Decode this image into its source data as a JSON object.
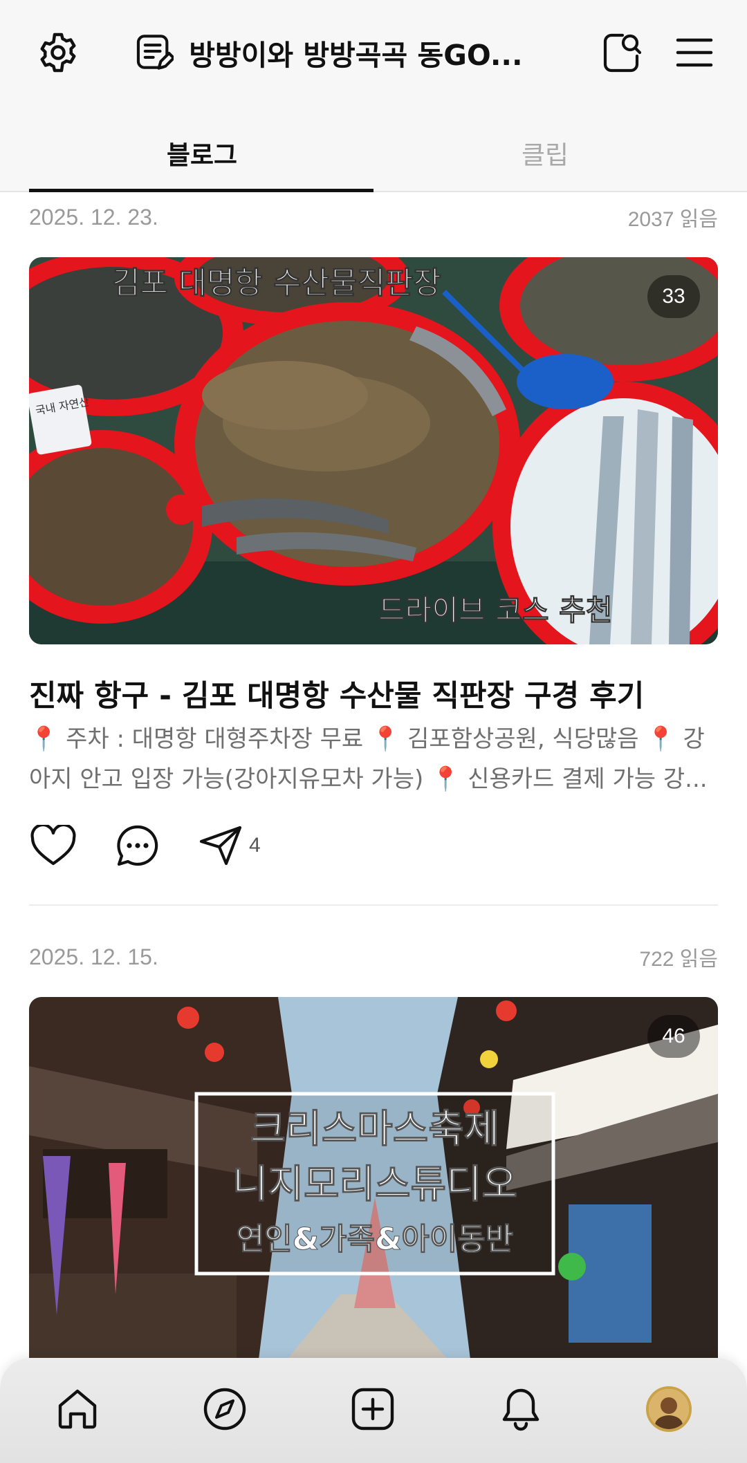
{
  "header": {
    "title": "방방이와 방방곡곡 동GO...",
    "icons": {
      "settings": "gear-icon",
      "blog_list": "blog-list-icon",
      "search": "search-icon",
      "menu": "hamburger-menu-icon"
    }
  },
  "tabs": [
    {
      "label": "블로그",
      "active": true
    },
    {
      "label": "클립",
      "active": false
    }
  ],
  "posts": [
    {
      "date": "2025. 12. 23.",
      "reads": "2037 읽음",
      "photo_count": "33",
      "image_caption_top": "김포 대명항 수산물직판장",
      "image_caption_bottom": "드라이브 코스 추천",
      "image_sign_text": "국내 자연산",
      "title": "진짜 항구 - 김포 대명항 수산물 직판장 구경 후기",
      "excerpt": "📍 주차 : 대명항 대형주차장 무료 📍 김포함상공원, 식당많음 📍 강아지 안고 입장 가능(강아지유모차 가능) 📍 신용카드 결제 가능 강...",
      "share_count": "4"
    },
    {
      "date": "2025. 12. 15.",
      "reads": "722 읽음",
      "photo_count": "46",
      "image_caption_lines": [
        "크리스마스축제",
        "니지모리스튜디오",
        "연인&가족&아이동반"
      ]
    }
  ],
  "bottom_nav": [
    {
      "icon": "home-icon"
    },
    {
      "icon": "compass-icon"
    },
    {
      "icon": "plus-square-icon"
    },
    {
      "icon": "bell-icon"
    },
    {
      "icon": "profile-avatar"
    }
  ],
  "colors": {
    "accent_text": "#111111",
    "muted_text": "#999999",
    "inactive_tab": "#a9a9a9",
    "tub_red": "#e4151c",
    "avatar_ring": "#c9a24a"
  }
}
